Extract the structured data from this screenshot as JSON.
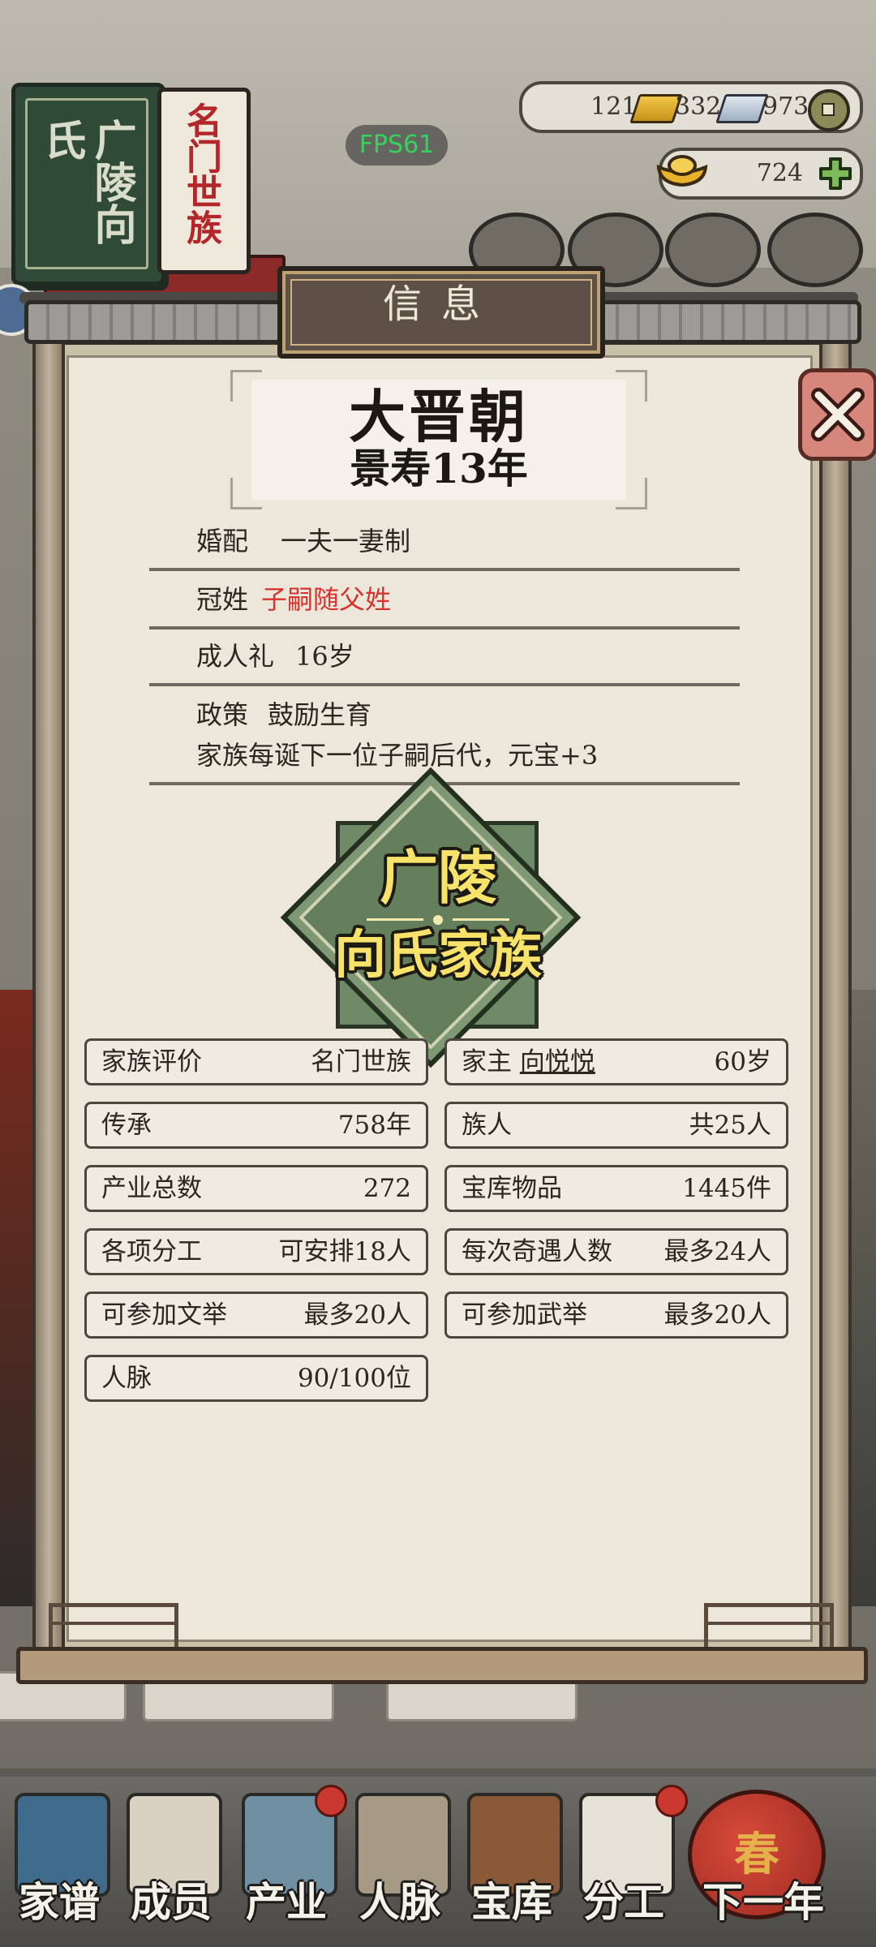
{
  "hud": {
    "fps": "FPS61",
    "resources": {
      "gold": "121",
      "silver": "332",
      "coins": "973",
      "ingots": "724"
    }
  },
  "clan_book": {
    "cover_title": "广陵向氏",
    "page_title": "名门世族"
  },
  "dialog": {
    "title": "信息",
    "dynasty": "大晋朝",
    "era_year": "景寿13年",
    "rules": [
      {
        "label": "婚配",
        "value": "一夫一妻制"
      },
      {
        "label": "冠姓",
        "value": "子嗣随父姓"
      },
      {
        "label": "成人礼",
        "value": "16岁"
      },
      {
        "label": "政策",
        "value": "鼓励生育",
        "detail": "家族每诞下一位子嗣后代，元宝+3"
      }
    ],
    "emblem": {
      "place": "广陵",
      "clan": "向氏家族"
    },
    "stats": {
      "left": [
        {
          "label": "家族评价",
          "value": "名门世族"
        },
        {
          "label": "传承",
          "value": "758年"
        },
        {
          "label": "产业总数",
          "value": "272"
        },
        {
          "label": "各项分工",
          "value": "可安排18人"
        },
        {
          "label": "可参加文举",
          "value": "最多20人"
        },
        {
          "label": "人脉",
          "value": "90/100位"
        }
      ],
      "right": [
        {
          "label": "家主",
          "name": "向悦悦",
          "value": "60岁"
        },
        {
          "label": "族人",
          "value": "共25人"
        },
        {
          "label": "宝库物品",
          "value": "1445件"
        },
        {
          "label": "每次奇遇人数",
          "value": "最多24人"
        },
        {
          "label": "可参加武举",
          "value": "最多20人"
        }
      ]
    }
  },
  "bottom_nav": [
    {
      "label": "家谱"
    },
    {
      "label": "成员"
    },
    {
      "label": "产业"
    },
    {
      "label": "人脉"
    },
    {
      "label": "宝库"
    },
    {
      "label": "分工"
    },
    {
      "label": "下一年"
    }
  ],
  "lantern_char": "春",
  "colors": {
    "accent_red": "#d6332f",
    "paper": "#ece7da",
    "fps_green": "#37d160"
  }
}
